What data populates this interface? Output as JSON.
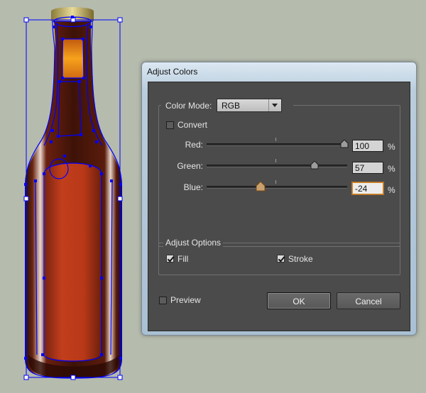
{
  "dialog": {
    "title": "Adjust Colors",
    "color_mode_label": "Color Mode:",
    "color_mode_value": "RGB",
    "convert_label": "Convert",
    "convert_checked": false,
    "channels": [
      {
        "label": "Red:",
        "value": "100",
        "unit": "%",
        "fraction": 1.0
      },
      {
        "label": "Green:",
        "value": "57",
        "unit": "%",
        "fraction": 0.785
      },
      {
        "label": "Blue:",
        "value": "-24",
        "unit": "%",
        "fraction": 0.38
      }
    ],
    "adjust_options_label": "Adjust Options",
    "fill_label": "Fill",
    "fill_checked": true,
    "stroke_label": "Stroke",
    "stroke_checked": true,
    "preview_label": "Preview",
    "preview_checked": false,
    "ok_label": "OK",
    "cancel_label": "Cancel"
  },
  "colors": {
    "canvas_bg": "#b5bbad",
    "dialog_bg": "#4b4b4b",
    "selection": "#0000ff",
    "bottle_body": "#b23a1a",
    "bottle_glass": "#4a1a0e",
    "bottle_neck_highlight": "#f39a18",
    "cap": "#c9b96b"
  }
}
